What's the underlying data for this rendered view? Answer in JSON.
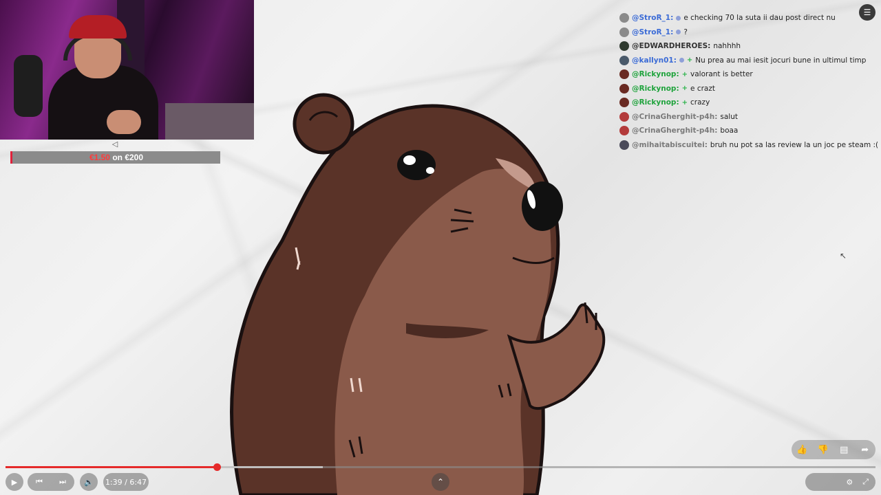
{
  "donation": {
    "current": "€1.50",
    "goal_text": "on €200",
    "progress_fraction": 0.0075
  },
  "chat": [
    {
      "user": "@StroR_1:",
      "user_color": "#3b6bd6",
      "avatar": "#8a8a8a",
      "badge": "dot",
      "message": "e checking 70 la suta ii dau post direct nu"
    },
    {
      "user": "@StroR_1:",
      "user_color": "#3b6bd6",
      "avatar": "#8a8a8a",
      "badge": "dot",
      "message": "?"
    },
    {
      "user": "@EDWARDHEROES:",
      "user_color": "#333333",
      "avatar": "#2f3a2f",
      "badge": "",
      "message": "nahhhh"
    },
    {
      "user": "@kallyn01:",
      "user_color": "#3b6bd6",
      "avatar": "#4a5a6a",
      "badge": "dot-plus",
      "message": "Nu prea au mai iesit jocuri bune in ultimul timp"
    },
    {
      "user": "@Rickynop:",
      "user_color": "#1fa33c",
      "avatar": "#6a2a22",
      "badge": "plus",
      "message": "valorant is better"
    },
    {
      "user": "@Rickynop:",
      "user_color": "#1fa33c",
      "avatar": "#6a2a22",
      "badge": "plus",
      "message": "e crazt"
    },
    {
      "user": "@Rickynop:",
      "user_color": "#1fa33c",
      "avatar": "#6a2a22",
      "badge": "plus",
      "message": "crazy"
    },
    {
      "user": "@CrinaGherghit-p4h:",
      "user_color": "#7a7a7a",
      "avatar": "#b33a3a",
      "badge": "",
      "message": "salut"
    },
    {
      "user": "@CrinaGherghit-p4h:",
      "user_color": "#7a7a7a",
      "avatar": "#b33a3a",
      "badge": "",
      "message": "boaa"
    },
    {
      "user": "@mihaitabiscuitei:",
      "user_color": "#7a7a7a",
      "avatar": "#4a4a5a",
      "badge": "",
      "message": "bruh nu pot sa las review la un joc pe steam :("
    }
  ],
  "player": {
    "time": "1:39 / 6:47",
    "played_fraction": 0.243,
    "buffered_fraction": 0.365,
    "icons": {
      "play": "play-icon",
      "prev": "previous-icon",
      "next": "next-icon",
      "volume": "volume-icon",
      "up": "chevron-up-icon",
      "settings": "settings-icon",
      "exit_fullscreen": "exit-fullscreen-icon"
    }
  },
  "actions": {
    "like": "thumbs-up-icon",
    "dislike": "thumbs-down-icon",
    "comments": "comment-icon",
    "share": "share-icon"
  },
  "colors": {
    "accent": "#e52a2a",
    "beaver_dark": "#5a3328",
    "beaver_light": "#8a5a4a"
  }
}
